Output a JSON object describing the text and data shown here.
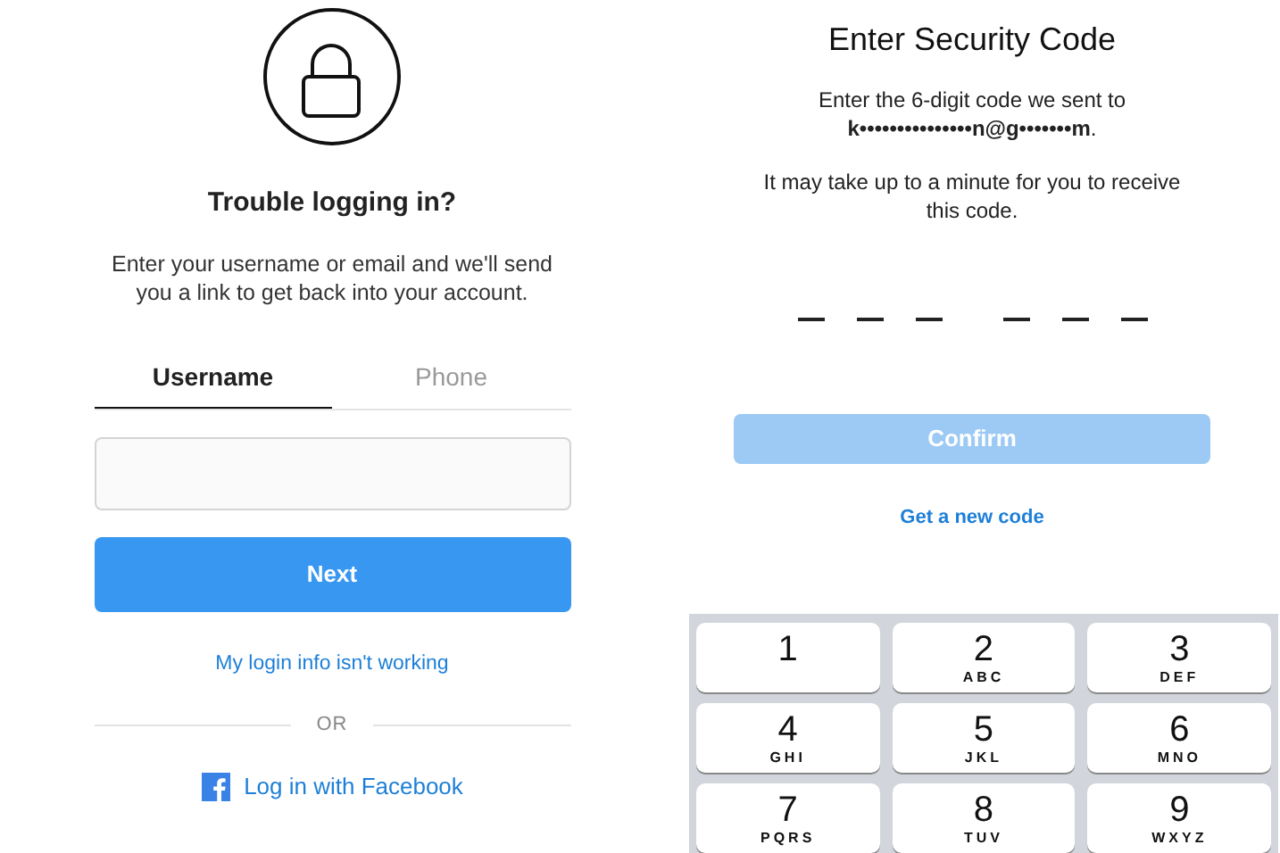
{
  "recovery": {
    "title": "Trouble logging in?",
    "description": "Enter your username or email and we'll send you a link to get back into your account.",
    "tabs": [
      {
        "label": "Username",
        "selected": true
      },
      {
        "label": "Phone",
        "selected": false
      }
    ],
    "next_button": "Next",
    "help_link": "My login info isn't working",
    "divider": "OR",
    "facebook_link": "Log in with Facebook"
  },
  "security": {
    "title": "Enter Security Code",
    "sent_to": "Enter the 6-digit code we sent to **k•••••••••••••••n@g•••••••m**.",
    "note": "It may take up to a minute for you to receive this code.",
    "confirm": {
      "label": "Confirm",
      "disabled": true
    },
    "resend_link": "Get a new code",
    "keypad": [
      {
        "digit": "1"
      },
      {
        "digit": "2",
        "letters": "ABC"
      },
      {
        "digit": "3",
        "letters": "DEF"
      },
      {
        "digit": "4",
        "letters": "GHI"
      },
      {
        "digit": "5",
        "letters": "JKL"
      },
      {
        "digit": "6",
        "letters": "MNO"
      },
      {
        "digit": "7",
        "letters": "PQRS"
      },
      {
        "digit": "8",
        "letters": "TUV"
      },
      {
        "digit": "9",
        "letters": "WXYZ"
      }
    ]
  }
}
